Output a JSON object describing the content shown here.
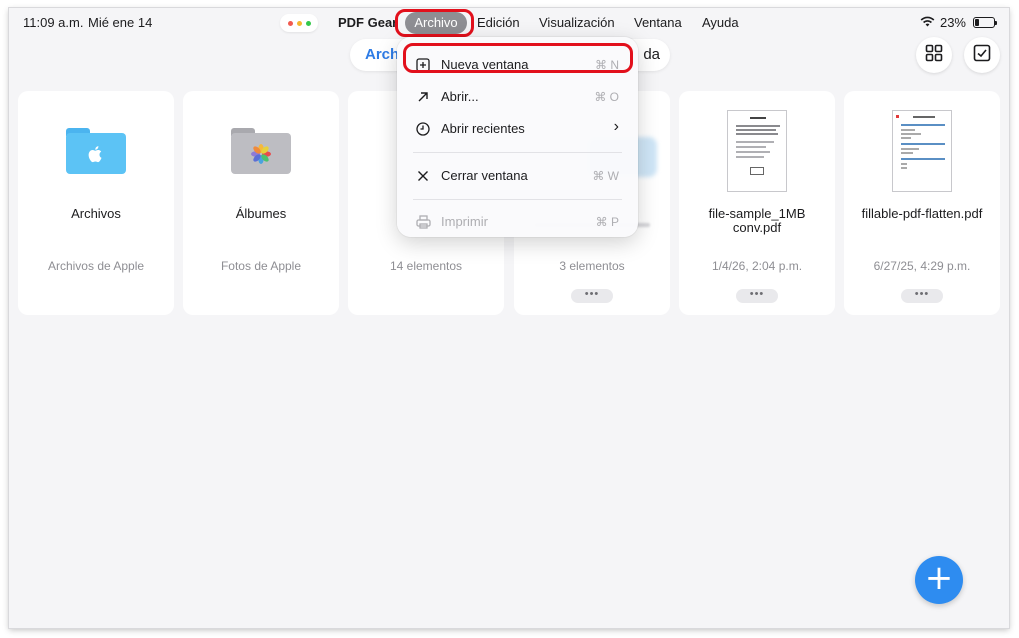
{
  "status": {
    "time": "11:09 a.m.",
    "date": "Mié ene 14",
    "battery": "23%",
    "battery_level": 0.23
  },
  "menubar": {
    "app": "PDF Gear",
    "items": [
      "Archivo",
      "Edición",
      "Visualización",
      "Ventana",
      "Ayuda"
    ]
  },
  "toolbar": {
    "segment_left": "Arch",
    "segment_right": "da"
  },
  "menu": {
    "items": [
      {
        "label": "Nueva ventana",
        "shortcut": "⌘ N",
        "icon": "plus-square-icon"
      },
      {
        "label": "Abrir...",
        "shortcut": "⌘ O",
        "icon": "arrow-up-right-icon"
      },
      {
        "label": "Abrir recientes",
        "shortcut": "›",
        "icon": "clock-icon"
      },
      {
        "label": "Cerrar ventana",
        "shortcut": "⌘ W",
        "icon": "close-icon"
      },
      {
        "label": "Imprimir",
        "shortcut": "⌘ P",
        "icon": "printer-icon"
      }
    ]
  },
  "cards": [
    {
      "name": "Archivos",
      "sub": "Archivos de Apple",
      "icon": "files-folder-icon"
    },
    {
      "name": "Álbumes",
      "sub": "Fotos de Apple",
      "icon": "photos-folder-icon"
    },
    {
      "name": "",
      "sub": "14 elementos",
      "icon": "folder-icon"
    },
    {
      "name": "",
      "sub": "3 elementos",
      "icon": "folder-icon"
    },
    {
      "name": "file-sample_1MB conv.pdf",
      "sub": "1/4/26, 2:04 p.m.",
      "icon": "pdf-thumbnail"
    },
    {
      "name": "fillable-pdf-flatten.pdf",
      "sub": "6/27/25, 4:29 p.m.",
      "icon": "pdf-thumbnail"
    }
  ],
  "more_label": "•••",
  "fab": {
    "label": "+"
  },
  "colors": {
    "accent": "#2e8cf0",
    "highlight": "#e2101c",
    "menu_selected": "#8e8e93"
  }
}
